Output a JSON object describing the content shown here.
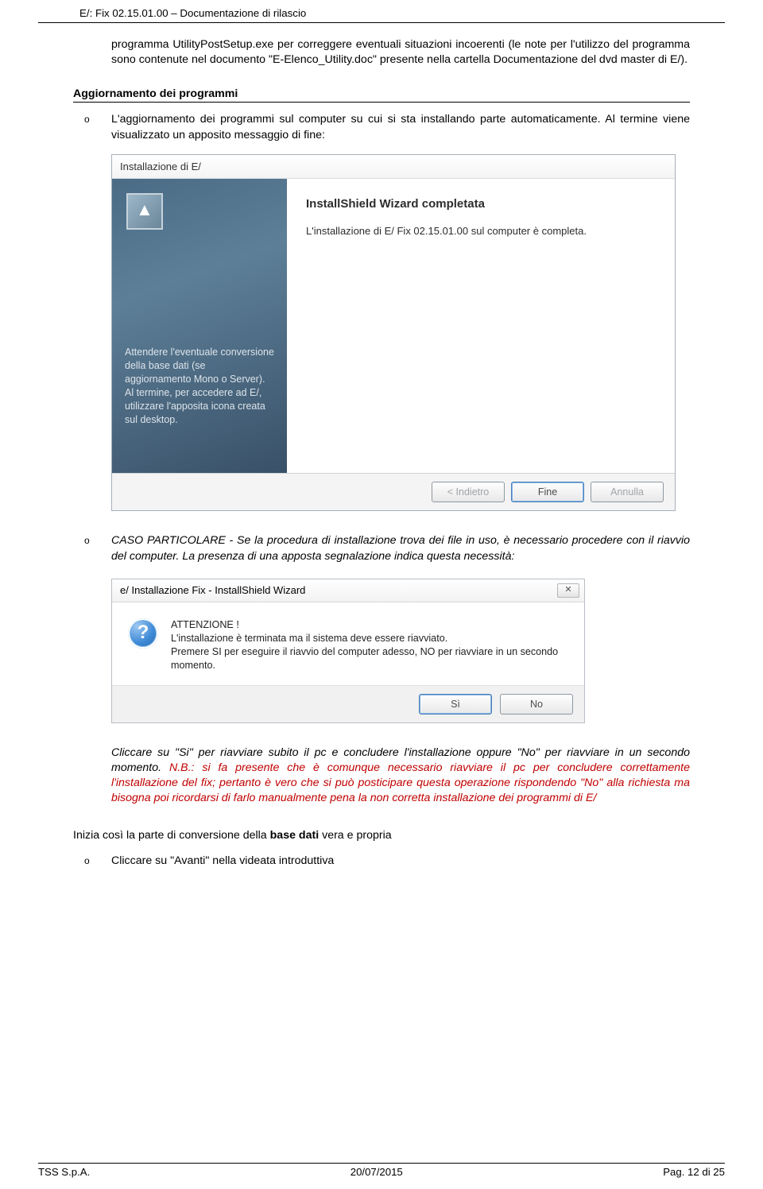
{
  "header": {
    "title": "E/: Fix 02.15.01.00 – Documentazione di rilascio"
  },
  "para1": "programma UtilityPostSetup.exe per correggere eventuali situazioni incoerenti (le note per l'utilizzo del programma sono contenute nel documento \"E-Elenco_Utility.doc\" presente nella cartella Documentazione del dvd master di E/).",
  "section_heading": "Aggiornamento dei programmi",
  "bullet_marker": "o",
  "bullet1": "L'aggiornamento dei programmi sul computer su cui si sta installando parte automaticamente. Al termine viene visualizzato un apposito messaggio di fine:",
  "wizard": {
    "title": "Installazione di E/",
    "heading": "InstallShield Wizard completata",
    "message": "L'installazione di E/ Fix 02.15.01.00 sul computer è completa.",
    "banner_msg": "Attendere l'eventuale conversione della base dati (se aggiornamento Mono o Server). Al termine, per accedere ad E/, utilizzare l'apposita icona creata sul desktop.",
    "btn_back": "< Indietro",
    "btn_finish": "Fine",
    "btn_cancel": "Annulla"
  },
  "bullet2": "CASO PARTICOLARE - Se la procedura di installazione trova dei file in uso, è necessario procedere con il riavvio del computer. La presenza di una apposta segnalazione indica questa necessità:",
  "dialog": {
    "title": "e/ Installazione Fix - InstallShield Wizard",
    "icon_glyph": "?",
    "line1": "ATTENZIONE !",
    "line2": "L'installazione è terminata ma il sistema deve essere riavviato.",
    "line3": "Premere SI per eseguire il riavvio del computer adesso, NO per riavviare in un secondo momento.",
    "btn_yes": "Sì",
    "btn_no": "No"
  },
  "para_after_dialog_black": "Cliccare su \"Si\" per riavviare subito il pc e concludere l'installazione oppure \"No\" per riavviare in un secondo momento. ",
  "para_after_dialog_red": "N.B.: si fa presente che è comunque necessario riavviare il pc per concludere correttamente l'installazione del fix; pertanto è vero che si può posticipare questa operazione rispondendo \"No\" alla richiesta ma bisogna poi ricordarsi di farlo manualmente pena la non corretta installazione dei programmi di E/",
  "para_base_dati_pre": "Inizia così la parte di conversione della ",
  "para_base_dati_bold": "base dati",
  "para_base_dati_post": " vera e propria",
  "bullet3": "Cliccare su \"Avanti\" nella videata introduttiva",
  "footer": {
    "left": "TSS S.p.A.",
    "center": "20/07/2015",
    "right": "Pag. 12 di 25"
  }
}
